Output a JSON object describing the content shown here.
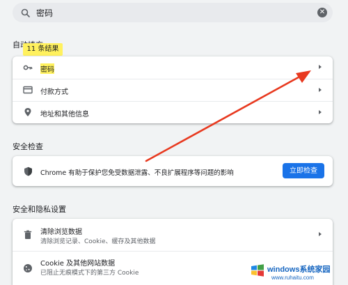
{
  "search": {
    "query": "密码"
  },
  "sections": {
    "autofill": "自动填充",
    "safety_check": "安全检查",
    "privacy": "安全和隐私设置"
  },
  "results_badge": "11 条结果",
  "autofill_items": [
    {
      "label": "密码",
      "icon": "key-icon"
    },
    {
      "label": "付款方式",
      "icon": "credit-card-icon"
    },
    {
      "label": "地址和其他信息",
      "icon": "location-pin-icon"
    }
  ],
  "safety_check": {
    "message": "Chrome 有助于保护您免受数据泄露、不良扩展程序等问题的影响",
    "button": "立即检查",
    "icon": "shield-icon"
  },
  "privacy_items": [
    {
      "label": "清除浏览数据",
      "sub": "清除浏览记录、Cookie、缓存及其他数据",
      "icon": "trash-icon"
    },
    {
      "label": "Cookie 及其他网站数据",
      "sub": "已阻止无痕模式下的第三方 Cookie",
      "icon": "cookie-icon"
    }
  ],
  "watermark": {
    "title": "windows系统家园",
    "url": "www.ruhaitu.com"
  },
  "colors": {
    "background": "#f1f3f4",
    "accent": "#1a73e8",
    "highlight": "#fff15e",
    "annotation_arrow": "#e8391f"
  }
}
